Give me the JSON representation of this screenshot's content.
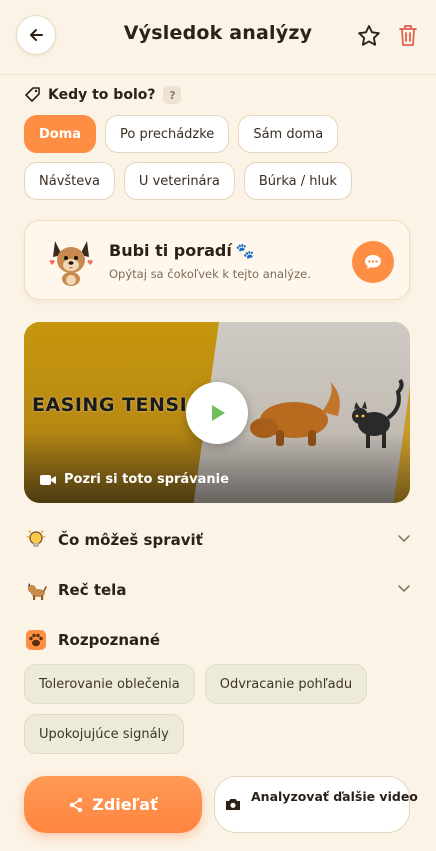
{
  "header": {
    "title": "Výsledok analýzy",
    "back_icon": "arrow-left-icon",
    "favorite_icon": "star-outline-icon",
    "delete_icon": "trash-icon"
  },
  "context": {
    "label": "Kedy to bolo?",
    "help": "?",
    "options": [
      [
        "Doma",
        "Po prechádzke",
        "Sám doma"
      ],
      [
        "Návšteva",
        "U veterinára",
        "Búrka / hluk"
      ]
    ],
    "selected": "Doma"
  },
  "advisor": {
    "title": "Bubi ti poradí",
    "subtitle": "Opýtaj sa čokoľvek k tejto analýze.",
    "title_icon": "paw-icon",
    "button_icon": "chat-bubble-icon"
  },
  "video": {
    "overlay_text": "EASING TENSIO",
    "caption": "Pozri si toto správanie",
    "caption_icon": "video-camera-icon",
    "play_icon": "play-icon"
  },
  "sections": [
    {
      "label": "Čo môžeš spraviť",
      "icon": "lightbulb-icon"
    },
    {
      "label": "Reč tela",
      "icon": "dog-icon"
    }
  ],
  "recognized": {
    "label": "Rozpoznané",
    "icon": "paw-badge-icon",
    "tags": [
      [
        "Tolerovanie oblečenia",
        "Odvracanie pohľadu"
      ],
      [
        "Upokojujúce signály"
      ]
    ]
  },
  "actions": {
    "share": "Zdieľať",
    "share_icon": "share-icon",
    "analyze": "Analyzovať ďalšie video",
    "analyze_icon": "camera-icon"
  },
  "colors": {
    "accent": "#FF8E45",
    "background": "#FBF3E6",
    "delete": "#E0604D",
    "tag_bg": "#EDEBD7"
  }
}
